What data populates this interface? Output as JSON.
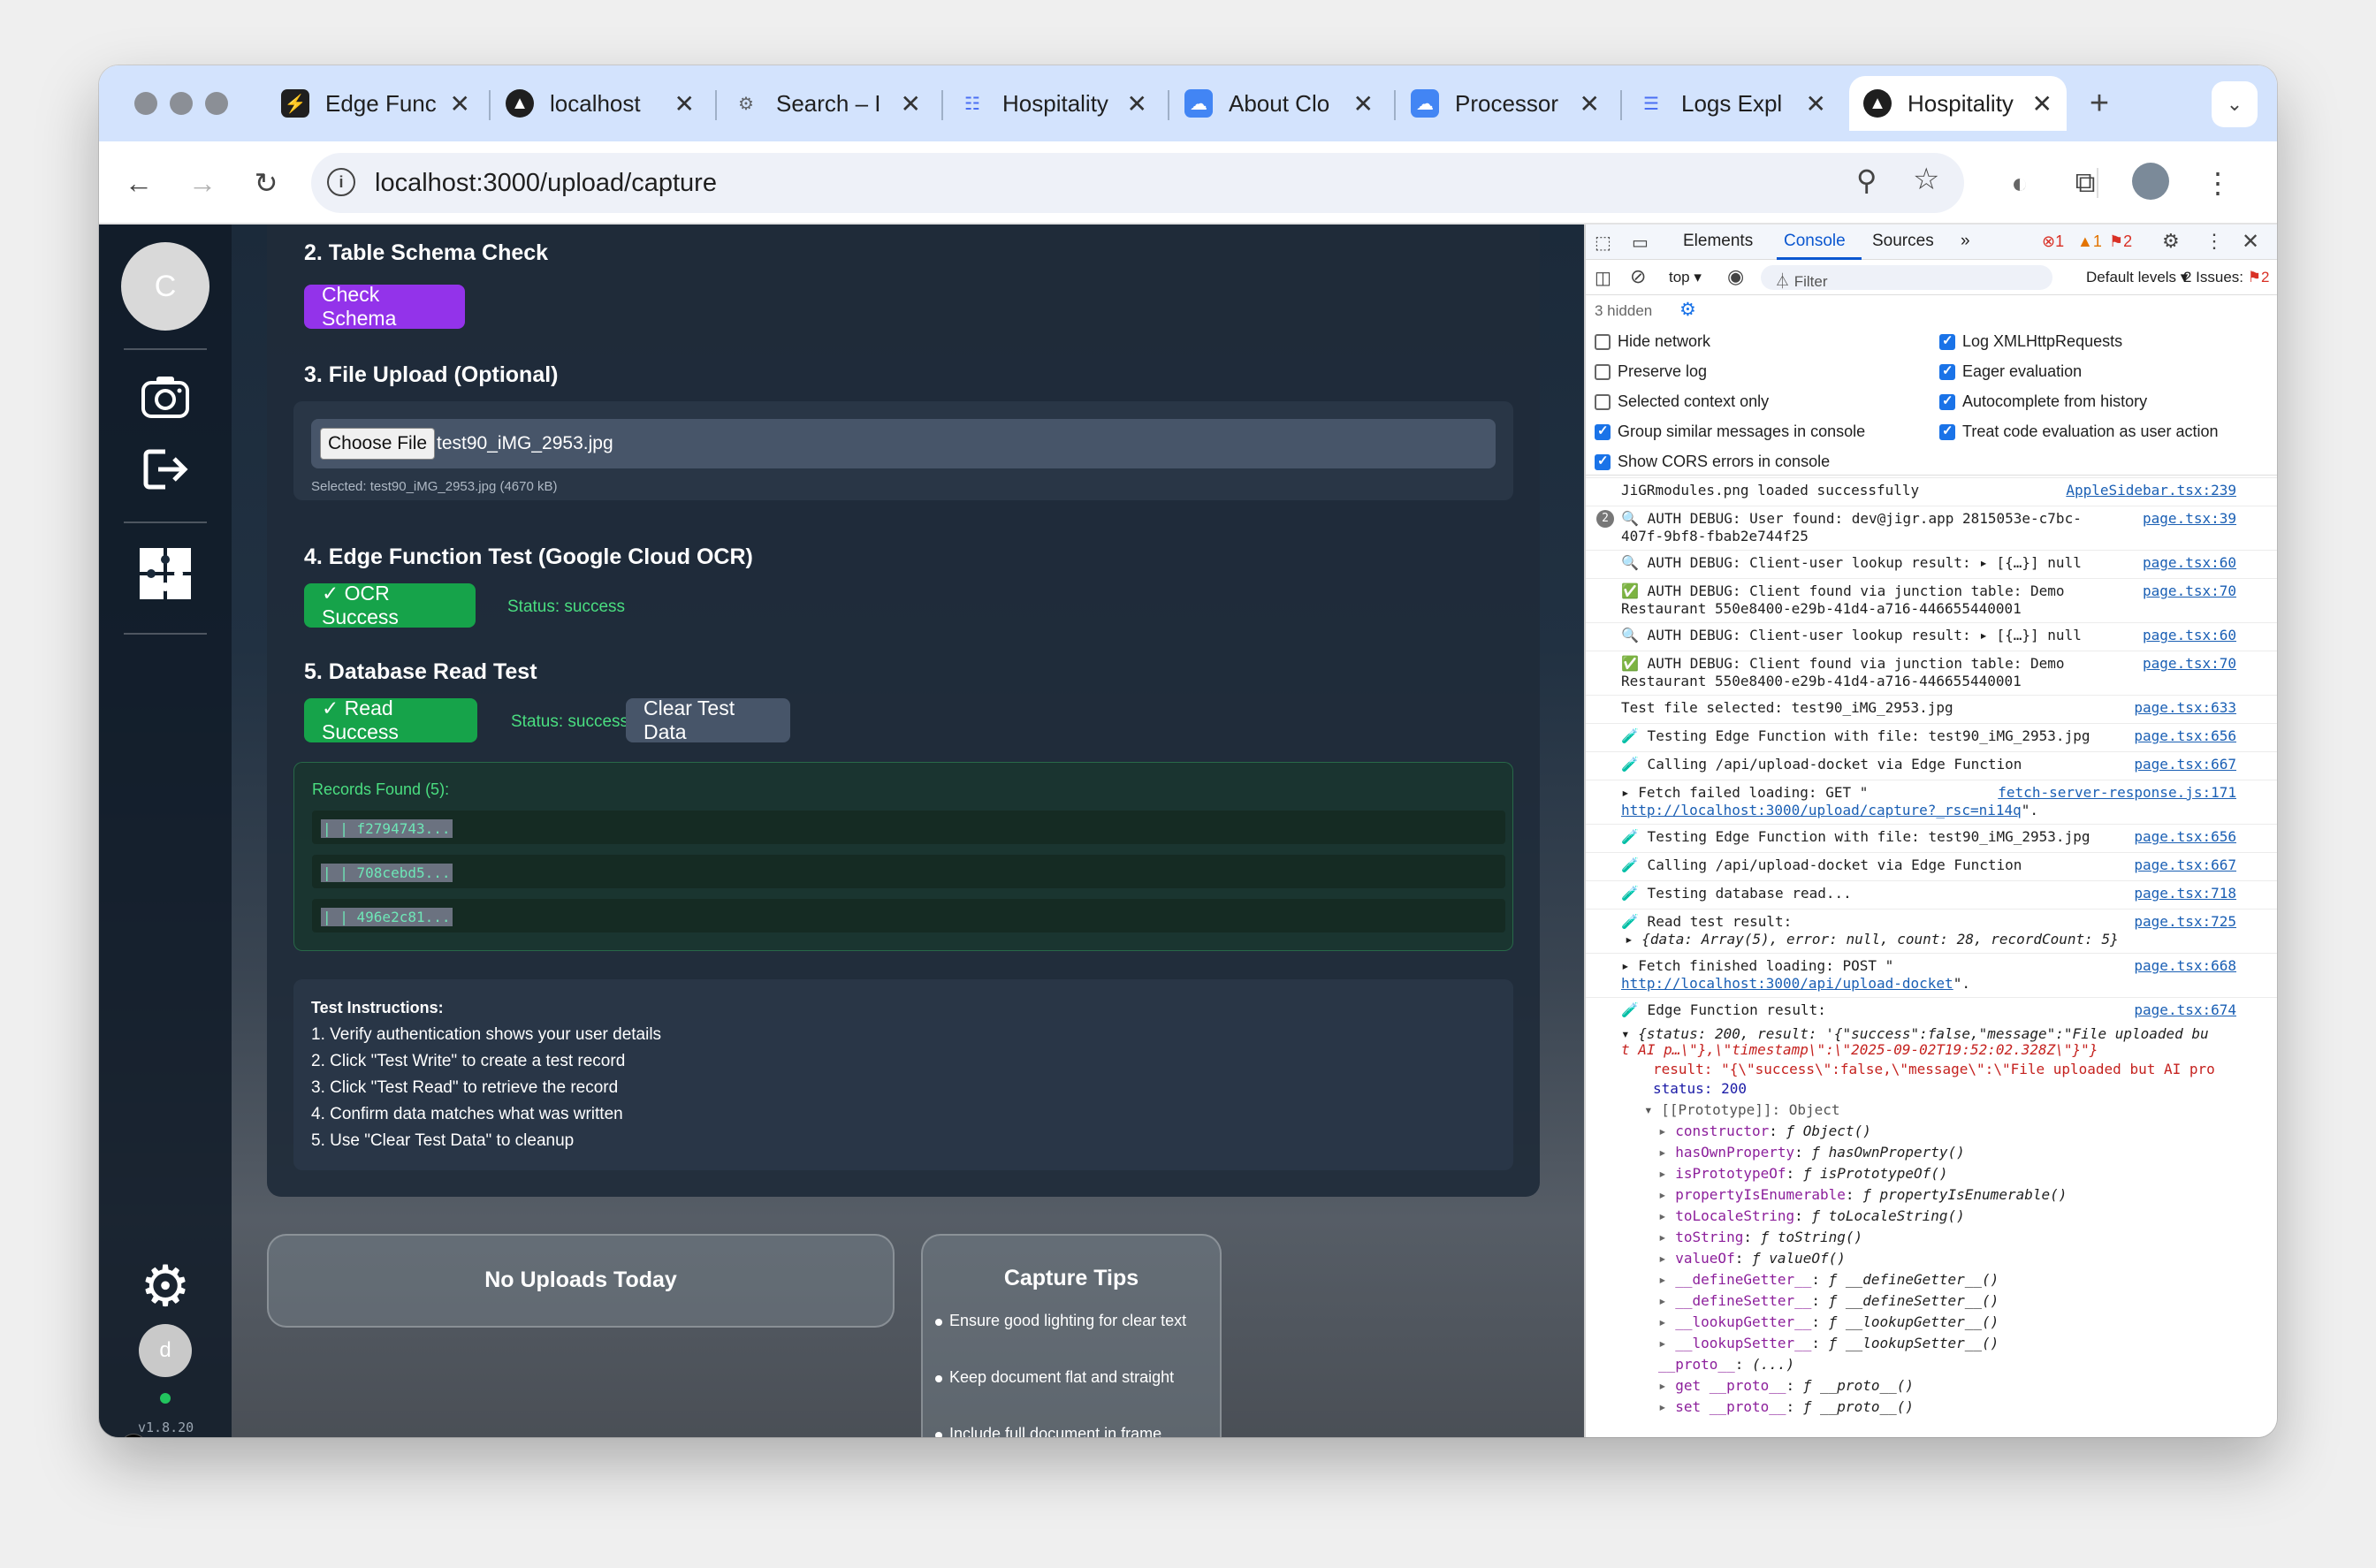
{
  "tabs": [
    {
      "title": "Edge Func",
      "icon": "supabase-icon",
      "color": "#1f1f1f"
    },
    {
      "title": "localhost",
      "icon": "triangle-icon",
      "color": "#1f1f1f"
    },
    {
      "title": "Search – I",
      "icon": "gear-icon",
      "color": "#5f6368"
    },
    {
      "title": "Hospitality",
      "icon": "doc-icon",
      "color": "#4a6ff3"
    },
    {
      "title": "About Clo",
      "icon": "gcloud-icon",
      "color": "#4285f4"
    },
    {
      "title": "Processor",
      "icon": "gcloud-icon",
      "color": "#4285f4"
    },
    {
      "title": "Logs Expl",
      "icon": "logs-icon",
      "color": "#4a6ff3"
    },
    {
      "title": "Hospitality",
      "icon": "triangle-icon",
      "color": "#1f1f1f"
    }
  ],
  "url": "localhost:3000/upload/capture",
  "sidebar": {
    "avatar_letter": "C",
    "user_letter": "d",
    "version": "v1.8.20"
  },
  "sections": {
    "schema_title": "2. Table Schema Check",
    "schema_btn": "Check Schema",
    "upload_title": "3. File Upload (Optional)",
    "choose_file": "Choose File",
    "file_name": "test90_iMG_2953.jpg",
    "selected": "Selected: test90_iMG_2953.jpg (4670 kB)",
    "edge_title": "4. Edge Function Test (Google Cloud OCR)",
    "ocr_btn": "✓ OCR Success",
    "ocr_status": "Status: success",
    "db_title": "5. Database Read Test",
    "read_btn": "✓ Read Success",
    "read_status": "Status: success",
    "clear_btn": "Clear Test Data",
    "records_title": "Records Found (5):",
    "records": [
      "| | f2794743...",
      "| | 708cebd5...",
      "| | 496e2c81..."
    ],
    "instr_title": "Test Instructions:",
    "instructions": [
      "1. Verify authentication shows your user details",
      "2. Click \"Test Write\" to create a test record",
      "3. Click \"Test Read\" to retrieve the record",
      "4. Confirm data matches what was written",
      "5. Use \"Clear Test Data\" to cleanup"
    ]
  },
  "bottom": {
    "no_uploads": "No Uploads Today",
    "tips_title": "Capture Tips",
    "tips": [
      "Ensure good lighting for clear text",
      "Keep document flat and straight",
      "Include full document in frame"
    ]
  },
  "devtools": {
    "tabs": [
      "Elements",
      "Console",
      "Sources"
    ],
    "errors": "1",
    "warnings": "1",
    "issues_badge": "2",
    "context": "top",
    "filter": "Filter",
    "levels": "Default levels",
    "issues": "2 Issues:",
    "issues_count": "2",
    "hidden": "3 hidden",
    "options_left": [
      "Hide network",
      "Preserve log",
      "Selected context only",
      "Group similar messages in console",
      "Show CORS errors in console"
    ],
    "options_left_on": [
      false,
      false,
      false,
      true,
      true
    ],
    "options_right": [
      "Log XMLHttpRequests",
      "Eager evaluation",
      "Autocomplete from history",
      "Treat code evaluation as user action"
    ],
    "options_right_on": [
      true,
      true,
      true,
      true
    ],
    "logs": [
      {
        "msg": "JiGRmodules.png loaded successfully",
        "src": "AppleSidebar.tsx:239"
      },
      {
        "msg": "🔍 AUTH DEBUG: User found: dev@jigr.app 2815053e-c7bc-",
        "msg2": "407f-9bf8-fbab2e744f25",
        "src": "page.tsx:39",
        "count": "2"
      },
      {
        "msg": "🔍 AUTH DEBUG: Client-user lookup result:  ▸ [{…}] null",
        "src": "page.tsx:60"
      },
      {
        "msg": "✅ AUTH DEBUG: Client found via junction table: Demo",
        "msg2": "Restaurant 550e8400-e29b-41d4-a716-446655440001",
        "src": "page.tsx:70"
      },
      {
        "msg": "🔍 AUTH DEBUG: Client-user lookup result:  ▸ [{…}] null",
        "src": "page.tsx:60"
      },
      {
        "msg": "✅ AUTH DEBUG: Client found via junction table: Demo",
        "msg2": "Restaurant 550e8400-e29b-41d4-a716-446655440001",
        "src": "page.tsx:70"
      },
      {
        "msg": "Test file selected: test90_iMG_2953.jpg",
        "src": "page.tsx:633"
      },
      {
        "msg": "🧪 Testing Edge Function with file: test90_iMG_2953.jpg",
        "src": "page.tsx:656"
      },
      {
        "msg": "🧪 Calling /api/upload-docket via Edge Function",
        "src": "page.tsx:667"
      },
      {
        "msg": "▸ Fetch failed loading: GET \"",
        "link": "http://localhost:3000/upload/capture?_rsc=ni14q",
        "after": "\".",
        "src": "fetch-server-response.js:171"
      },
      {
        "msg": "🧪 Testing Edge Function with file: test90_iMG_2953.jpg",
        "src": "page.tsx:656"
      },
      {
        "msg": "🧪 Calling /api/upload-docket via Edge Function",
        "src": "page.tsx:667"
      },
      {
        "msg": "🧪 Testing database read...",
        "src": "page.tsx:718"
      },
      {
        "msg": "🧪 Read test result:",
        "msg2": "▸ {data: Array(5), error: null, count: 28, recordCount: 5}",
        "src": "page.tsx:725"
      },
      {
        "msg": "▸ Fetch finished loading: POST \"",
        "link": "http://localhost:3000/api/upload-docket",
        "after": "\".",
        "src": "page.tsx:668"
      },
      {
        "msg": "🧪 Edge Function result:",
        "src": "page.tsx:674"
      }
    ],
    "result_obj": "▾ {status: 200, result: '{\"success\":false,\"message\":\"File uploaded bu",
    "result_obj2": "t AI p…\\\"},\\\"timestamp\\\":\\\"2025-09-02T19:52:02.328Z\\\"}\"}",
    "result_line": "result: \"{\\\"success\\\":false,\\\"message\\\":\\\"File uploaded but AI pro",
    "status_line": "status: 200",
    "prototype": "▾ [[Prototype]]: Object",
    "proto_items": [
      [
        "constructor",
        "ƒ Object()"
      ],
      [
        "hasOwnProperty",
        "ƒ hasOwnProperty()"
      ],
      [
        "isPrototypeOf",
        "ƒ isPrototypeOf()"
      ],
      [
        "propertyIsEnumerable",
        "ƒ propertyIsEnumerable()"
      ],
      [
        "toLocaleString",
        "ƒ toLocaleString()"
      ],
      [
        "toString",
        "ƒ toString()"
      ],
      [
        "valueOf",
        "ƒ valueOf()"
      ],
      [
        "__defineGetter__",
        "ƒ __defineGetter__()"
      ],
      [
        "__defineSetter__",
        "ƒ __defineSetter__()"
      ],
      [
        "__lookupGetter__",
        "ƒ __lookupGetter__()"
      ],
      [
        "__lookupSetter__",
        "ƒ __lookupSetter__()"
      ],
      [
        "__proto__",
        "(...)"
      ],
      [
        "get __proto__",
        "ƒ __proto__()"
      ],
      [
        "set __proto__",
        "ƒ __proto__()"
      ]
    ]
  }
}
